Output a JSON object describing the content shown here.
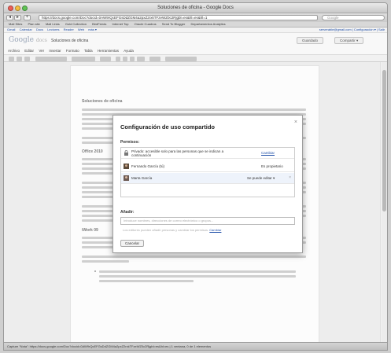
{
  "window": {
    "title": "Soluciones de oficina - Google Docs"
  },
  "nav": {
    "back": "◂",
    "forward": "▸",
    "add": "+",
    "url": "https://docs.google.com/Doc?docid=0AW9rQcEFGsDdZGM4a2pxZ2rxkTFzeWZ0c2Rjgbl=es&hl=es&hl=1",
    "search_placeholder": "Google"
  },
  "bookmarks": [
    "Mail Sites",
    "Plan site",
    "Mail Links",
    "Gold Collection",
    "BirdFeeds",
    "Internet Top",
    "Oracle Cuadros",
    "Send To Blogger",
    "Departamentos Analytics"
  ],
  "gbar": {
    "left": [
      "Gmail",
      "Calendar",
      "Docs",
      "Lectores",
      "Reader",
      "Web",
      "más ▾"
    ],
    "right": "serverable@gmail.com | Configuración ▾ | Salir"
  },
  "header": {
    "logo": "Google",
    "logo_suffix": "docs",
    "doc_name": "Soluciones de oficina",
    "save_button": "Guardado",
    "share_button": "Compartir ▾"
  },
  "menu": [
    "Archivo",
    "Editar",
    "Ver",
    "Insertar",
    "Formato",
    "Tabla",
    "Herramientas",
    "Ayuda"
  ],
  "doc": {
    "heading1": "Soluciones de oficina",
    "heading2": "Office 2010",
    "heading3": "iWork 09"
  },
  "dialog": {
    "title": "Configuración de uso compartido",
    "permissions_label": "Permisos:",
    "rows": [
      {
        "text": "Privado: accesible solo para las personas que se indican a continuación",
        "right": "Cambiar",
        "right_is_link": true
      },
      {
        "text": "Fernando García (tú)",
        "right": "Es propietario",
        "right_is_link": false
      },
      {
        "text": "Marta García",
        "right": "Se puede editar ▾",
        "right_is_link": false
      }
    ],
    "add_label": "Añadir:",
    "add_placeholder": "Introduce nombres, direcciones de correo electrónico o grupos...",
    "note": "Los editores pueden añadir personas y cambiar los permisos.",
    "note_link": "Cambiar",
    "cancel_button": "Cancelar",
    "close_icon": "×"
  },
  "status": "Capture “Nota”: https://docs.google.com/Doc?docid=0AW9rQcEFGsDdZGM4a2pxZ2rxkTFzeWZ0c2Rjgbl=es&hl=es | 1 ventana, 0 de 1 elementos"
}
